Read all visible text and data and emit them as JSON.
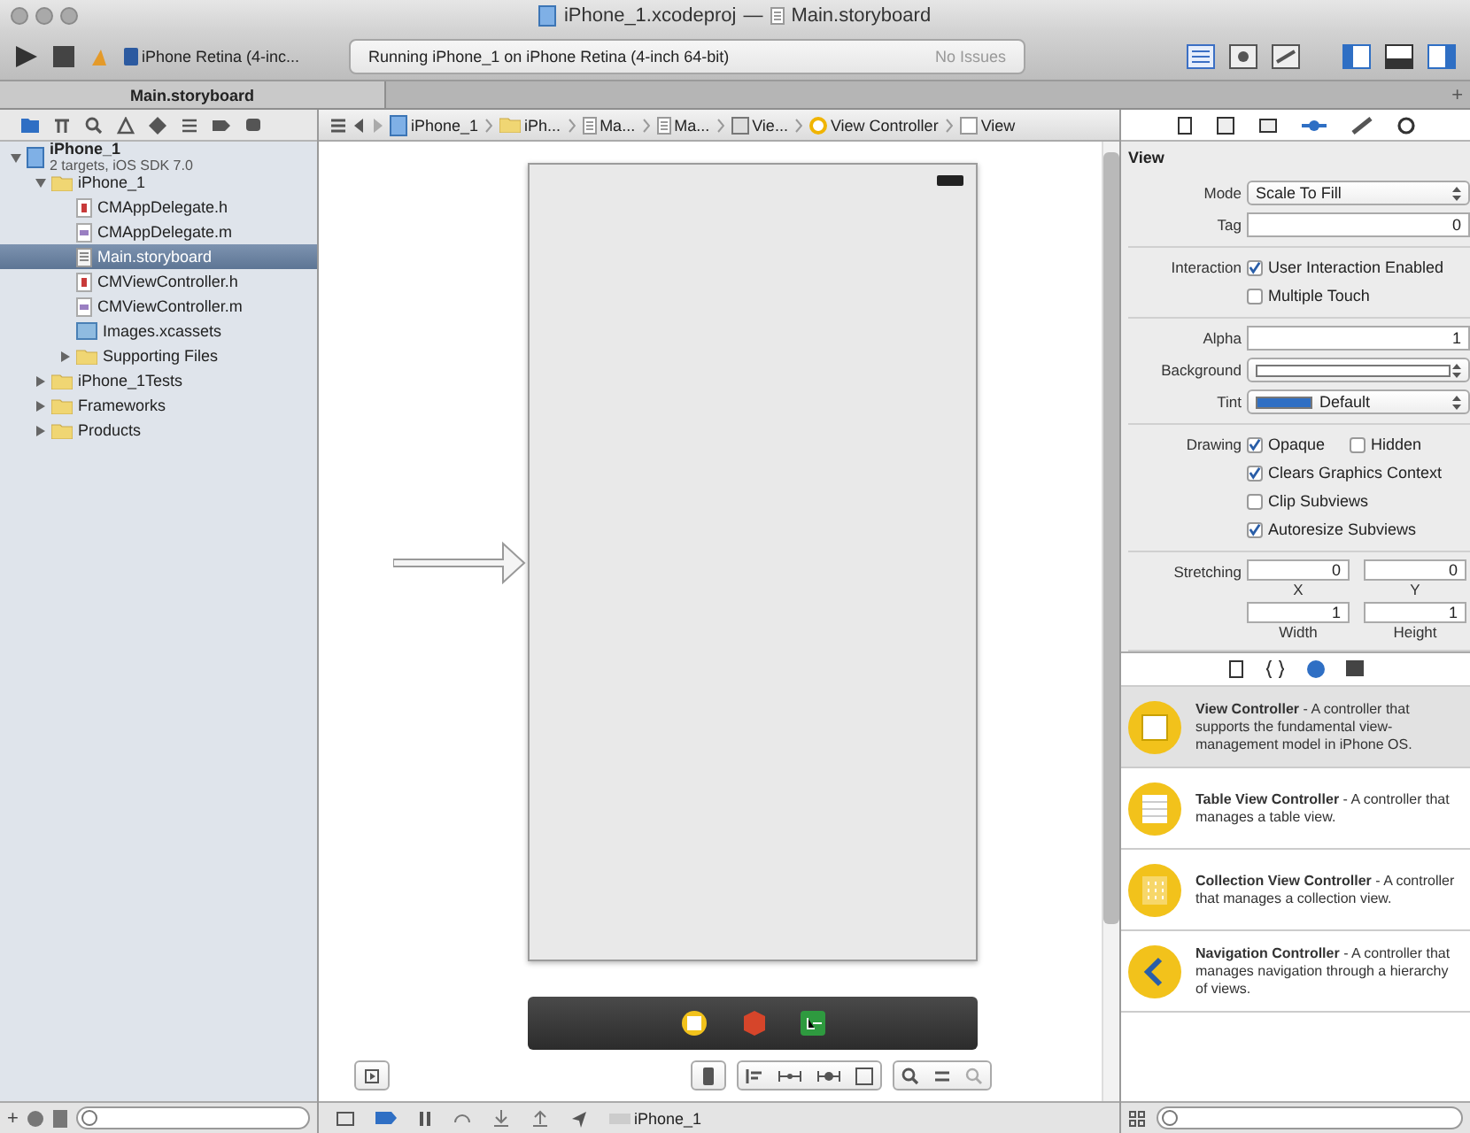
{
  "window": {
    "project": "iPhone_1.xcodeproj",
    "separator": "—",
    "file": "Main.storyboard"
  },
  "toolbar": {
    "scheme": "iPhone Retina (4-inc...",
    "activity": "Running iPhone_1 on iPhone Retina (4-inch 64-bit)",
    "issues": "No Issues"
  },
  "tabs": [
    {
      "label": "Main.storyboard",
      "selected": true
    }
  ],
  "tab_add": "+",
  "navigator": [
    {
      "label": "iPhone_1",
      "subtitle": "2 targets, iOS SDK 7.0",
      "kind": "project",
      "expanded": true,
      "selected": false,
      "children": [
        {
          "label": "iPhone_1",
          "kind": "folder",
          "expanded": true,
          "selected": false,
          "children": [
            {
              "label": "CMAppDelegate.h",
              "kind": "header",
              "selected": false
            },
            {
              "label": "CMAppDelegate.m",
              "kind": "source",
              "selected": false
            },
            {
              "label": "Main.storyboard",
              "kind": "storyboard",
              "selected": true
            },
            {
              "label": "CMViewController.h",
              "kind": "header",
              "selected": false
            },
            {
              "label": "CMViewController.m",
              "kind": "source",
              "selected": false
            },
            {
              "label": "Images.xcassets",
              "kind": "assets",
              "selected": false
            },
            {
              "label": "Supporting Files",
              "kind": "folder",
              "expanded": false,
              "selected": false
            }
          ]
        },
        {
          "label": "iPhone_1Tests",
          "kind": "folder",
          "expanded": false,
          "selected": false
        },
        {
          "label": "Frameworks",
          "kind": "folder",
          "expanded": false,
          "selected": false
        },
        {
          "label": "Products",
          "kind": "folder",
          "expanded": false,
          "selected": false
        }
      ]
    }
  ],
  "navigator_footer": {
    "add": "+"
  },
  "jump_bar": [
    {
      "label": "iPhone_1",
      "kind": "project"
    },
    {
      "label": "iPh...",
      "kind": "folder"
    },
    {
      "label": "Ma...",
      "kind": "file"
    },
    {
      "label": "Ma...",
      "kind": "file"
    },
    {
      "label": "Vie...",
      "kind": "scene"
    },
    {
      "label": "View Controller",
      "kind": "controller"
    },
    {
      "label": "View",
      "kind": "view"
    }
  ],
  "inspector": {
    "section": "View",
    "rows": [
      {
        "kind": "select",
        "label": "Mode",
        "value": "Scale To Fill"
      },
      {
        "kind": "number",
        "label": "Tag",
        "value": "0"
      },
      {
        "kind": "checks",
        "label": "Interaction",
        "lines": [
          {
            "options": [
              {
                "label": "User Interaction Enabled",
                "checked": true
              }
            ]
          },
          {
            "options": [
              {
                "label": "Multiple Touch",
                "checked": false
              }
            ]
          }
        ]
      },
      {
        "kind": "number",
        "label": "Alpha",
        "value": "1"
      },
      {
        "kind": "color",
        "label": "Background",
        "color": "#ffffff"
      },
      {
        "kind": "color",
        "label": "Tint",
        "color": "#2f6fc4",
        "value": "Default"
      },
      {
        "kind": "checks",
        "label": "Drawing",
        "lines": [
          {
            "options": [
              {
                "label": "Opaque",
                "checked": true
              },
              {
                "label": "Hidden",
                "checked": false
              }
            ]
          },
          {
            "options": [
              {
                "label": "Clears Graphics Context",
                "checked": true
              }
            ]
          },
          {
            "options": [
              {
                "label": "Clip Subviews",
                "checked": false
              }
            ]
          },
          {
            "options": [
              {
                "label": "Autoresize Subviews",
                "checked": true
              }
            ]
          }
        ]
      },
      {
        "kind": "pairs",
        "label": "Stretching",
        "fields": [
          {
            "value": "0",
            "caption": "X"
          },
          {
            "value": "0",
            "caption": "Y"
          },
          {
            "value": "1",
            "caption": "Width"
          },
          {
            "value": "1",
            "caption": "Height"
          }
        ]
      }
    ]
  },
  "library": [
    {
      "text": "**View Controller** - A controller that supports the fundamental view-management model in iPhone OS.",
      "kind": "view",
      "selected": true
    },
    {
      "text": "**Table View Controller** - A controller that manages a table view.",
      "kind": "table",
      "selected": false
    },
    {
      "text": "**Collection View Controller** - A controller that manages a collection view.",
      "kind": "collection",
      "selected": false
    },
    {
      "text": "**Navigation Controller** - A controller that manages navigation through a hierarchy of views.",
      "kind": "navigation",
      "selected": false
    }
  ],
  "debug_bar": {
    "target": "iPhone_1"
  }
}
